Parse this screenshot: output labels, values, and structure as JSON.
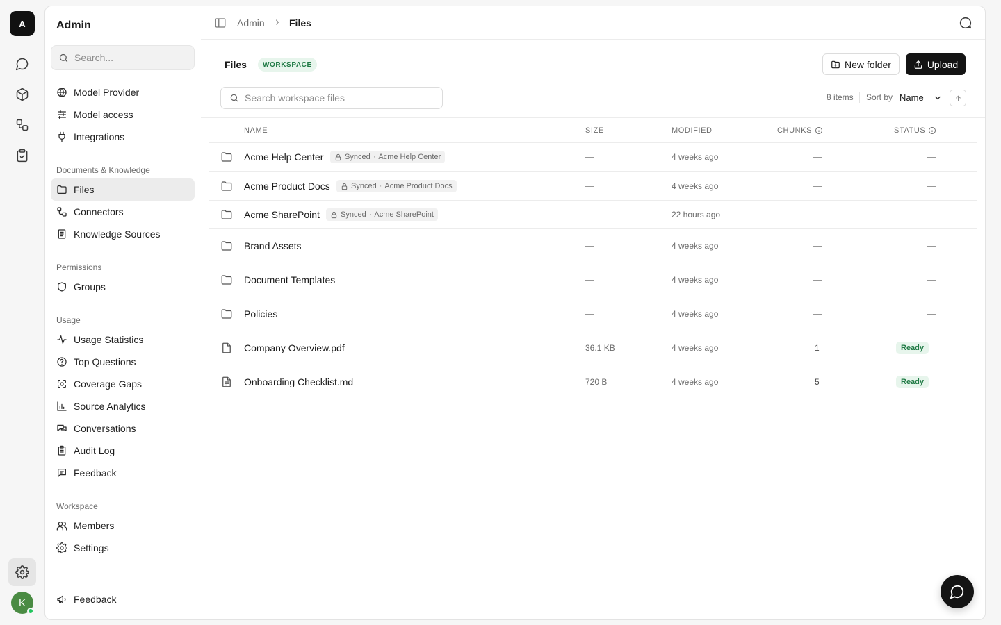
{
  "rail": {
    "logo": "A",
    "avatar": "K"
  },
  "sidebar": {
    "title": "Admin",
    "search_placeholder": "Search...",
    "items_top": [
      {
        "label": "Model Provider",
        "icon": "globe-icon"
      },
      {
        "label": "Model access",
        "icon": "sliders-icon"
      },
      {
        "label": "Integrations",
        "icon": "plug-icon"
      }
    ],
    "sections": [
      {
        "title": "Documents & Knowledge",
        "items": [
          {
            "label": "Files",
            "icon": "folder-icon",
            "active": true
          },
          {
            "label": "Connectors",
            "icon": "connector-icon"
          },
          {
            "label": "Knowledge Sources",
            "icon": "book-icon"
          }
        ]
      },
      {
        "title": "Permissions",
        "items": [
          {
            "label": "Groups",
            "icon": "shield-icon"
          }
        ]
      },
      {
        "title": "Usage",
        "items": [
          {
            "label": "Usage Statistics",
            "icon": "activity-icon"
          },
          {
            "label": "Top Questions",
            "icon": "help-circle-icon"
          },
          {
            "label": "Coverage Gaps",
            "icon": "scan-icon"
          },
          {
            "label": "Source Analytics",
            "icon": "bar-chart-icon"
          },
          {
            "label": "Conversations",
            "icon": "messages-icon"
          },
          {
            "label": "Audit Log",
            "icon": "clipboard-icon"
          },
          {
            "label": "Feedback",
            "icon": "message-square-icon"
          }
        ]
      },
      {
        "title": "Workspace",
        "items": [
          {
            "label": "Members",
            "icon": "users-icon"
          },
          {
            "label": "Settings",
            "icon": "gear-icon"
          }
        ]
      }
    ],
    "footer_feedback": "Feedback"
  },
  "topbar": {
    "crumb_root": "Admin",
    "crumb_current": "Files"
  },
  "files": {
    "title": "Files",
    "badge": "WORKSPACE",
    "new_folder_label": "New folder",
    "upload_label": "Upload",
    "search_placeholder": "Search workspace files",
    "item_count": "8 items",
    "sort_label": "Sort by",
    "sort_value": "Name",
    "columns": {
      "name": "NAME",
      "size": "SIZE",
      "modified": "MODIFIED",
      "chunks": "CHUNKS",
      "status": "STATUS"
    },
    "rows": [
      {
        "name": "Acme Help Center",
        "type": "folder",
        "synced": "Synced",
        "source": "Acme Help Center",
        "size": "—",
        "modified": "4 weeks ago",
        "chunks": "—",
        "status": "—"
      },
      {
        "name": "Acme Product Docs",
        "type": "folder",
        "synced": "Synced",
        "source": "Acme Product Docs",
        "size": "—",
        "modified": "4 weeks ago",
        "chunks": "—",
        "status": "—"
      },
      {
        "name": "Acme SharePoint",
        "type": "folder",
        "synced": "Synced",
        "source": "Acme SharePoint",
        "size": "—",
        "modified": "22 hours ago",
        "chunks": "—",
        "status": "—"
      },
      {
        "name": "Brand Assets",
        "type": "folder",
        "size": "—",
        "modified": "4 weeks ago",
        "chunks": "—",
        "status": "—"
      },
      {
        "name": "Document Templates",
        "type": "folder",
        "size": "—",
        "modified": "4 weeks ago",
        "chunks": "—",
        "status": "—"
      },
      {
        "name": "Policies",
        "type": "folder",
        "size": "—",
        "modified": "4 weeks ago",
        "chunks": "—",
        "status": "—"
      },
      {
        "name": "Company Overview.pdf",
        "type": "file",
        "size": "36.1 KB",
        "modified": "4 weeks ago",
        "chunks": "1",
        "status": "Ready"
      },
      {
        "name": "Onboarding Checklist.md",
        "type": "text-file",
        "size": "720 B",
        "modified": "4 weeks ago",
        "chunks": "5",
        "status": "Ready"
      }
    ]
  },
  "colors": {
    "accent_dark": "#141414",
    "ready_bg": "#e7f5ec",
    "ready_text": "#207a45",
    "avatar": "#4a8b43"
  }
}
